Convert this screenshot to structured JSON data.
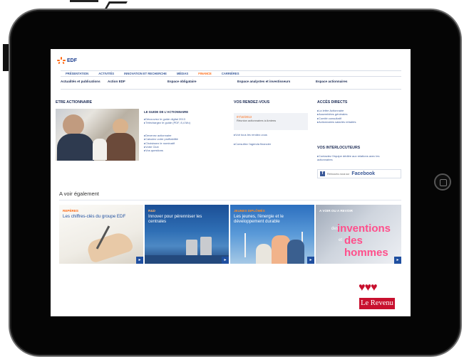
{
  "site": {
    "brand": "EDF"
  },
  "nav": {
    "items": [
      {
        "label": "PRÉSENTATION",
        "active": false
      },
      {
        "label": "ACTIVITÉS",
        "active": false
      },
      {
        "label": "INNOVATION ET RECHERCHE",
        "active": false
      },
      {
        "label": "MÉDIAS",
        "active": false
      },
      {
        "label": "FINANCE",
        "active": true
      },
      {
        "label": "CARRIÈRES",
        "active": false
      }
    ]
  },
  "subnav": {
    "items": [
      "Actualités et publications",
      "Action EDF",
      "Espace obligataire",
      "Espace analystes et investisseurs",
      "Espace actionnaires"
    ]
  },
  "shareholder": {
    "title": "ETRE ACTIONNAIRE",
    "guide_title": "LE GUIDE DE L'ACTIONNAIRE",
    "guide_links": [
      "Découvrez le guide digital 2013",
      "Téléchargez le guide (PDF, 8,4 Mo)"
    ],
    "links": [
      "Devenez actionnaire",
      "Calculez votre profitabilité",
      "Choisissez le nominatif",
      "Votre Club",
      "Vos questions"
    ]
  },
  "appointments": {
    "title": "VOS RENDEZ-VOUS",
    "event_date": "07/10/2013",
    "event_text": "Réunion actionnaires à Amiens",
    "links": [
      "Voir tous les rendez-vous",
      "Consultez l'agenda financier"
    ]
  },
  "direct_access": {
    "title": "ACCÈS DIRECTS",
    "links": [
      "La lettre Actionnaire",
      "Assemblées générales",
      "Comité consultatif",
      "Actionnaires salariés retraités"
    ]
  },
  "contacts": {
    "title": "VOS INTERLOCUTEURS",
    "text": "Contactez l'équipe dédiée aux relations avec les actionnaires"
  },
  "facebook": {
    "prefix": "Retrouvez-nous sur",
    "brand": "Facebook"
  },
  "see_also": {
    "title": "A voir également",
    "tiles": [
      {
        "kicker": "REPÈRES",
        "title": "Les chiffres-clés du groupe EDF"
      },
      {
        "kicker": "R&D",
        "title": "Innover pour pérenniser les centrales"
      },
      {
        "kicker": "JEUNES DIPLÔMÉS",
        "title": "Les jeunes, l'énergie et le développement durable"
      },
      {
        "kicker": "A VOIR OU A REVOIR",
        "words": [
          "des",
          "inventions",
          "et",
          "des hommes"
        ]
      }
    ]
  },
  "watermark": {
    "hearts": "♥♥♥",
    "label": "Le Revenu"
  }
}
